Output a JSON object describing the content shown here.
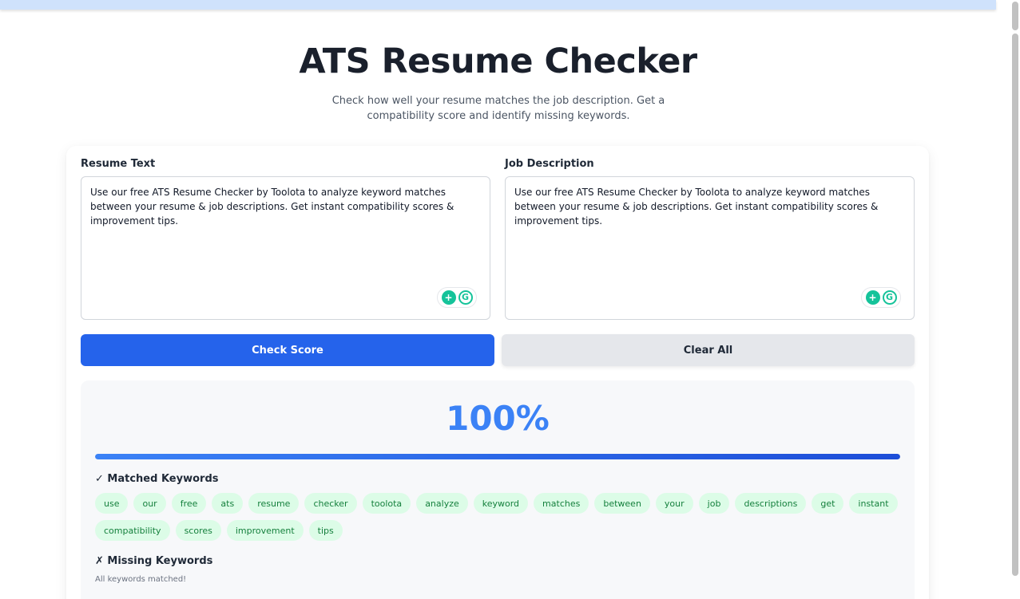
{
  "title": "ATS Resume Checker",
  "subtitle": "Check how well your resume matches the job description. Get a compatibility score and identify missing keywords.",
  "resume": {
    "label": "Resume Text",
    "value": "Use our free ATS Resume Checker by Toolota to analyze keyword matches between your resume & job descriptions. Get instant compatibility scores & improvement tips."
  },
  "job": {
    "label": "Job Description",
    "value": "Use our free ATS Resume Checker by Toolota to analyze keyword matches between your resume & job descriptions. Get instant compatibility scores & improvement tips."
  },
  "buttons": {
    "check": "Check Score",
    "clear": "Clear All"
  },
  "result": {
    "score_text": "100%",
    "score_value": 100,
    "matched_heading": "✓ Matched Keywords",
    "matched": [
      "use",
      "our",
      "free",
      "ats",
      "resume",
      "checker",
      "toolota",
      "analyze",
      "keyword",
      "matches",
      "between",
      "your",
      "job",
      "descriptions",
      "get",
      "instant",
      "compatibility",
      "scores",
      "improvement",
      "tips"
    ],
    "missing_heading": "✗ Missing Keywords",
    "missing_note": "All keywords matched!"
  },
  "icons": {
    "grammarly_assist": "lightbulb-icon",
    "grammarly_logo": "grammarly-icon"
  },
  "colors": {
    "primary": "#2563eb",
    "score": "#3b82f6",
    "chip_bg": "#dcfce7",
    "chip_text": "#15803d"
  }
}
